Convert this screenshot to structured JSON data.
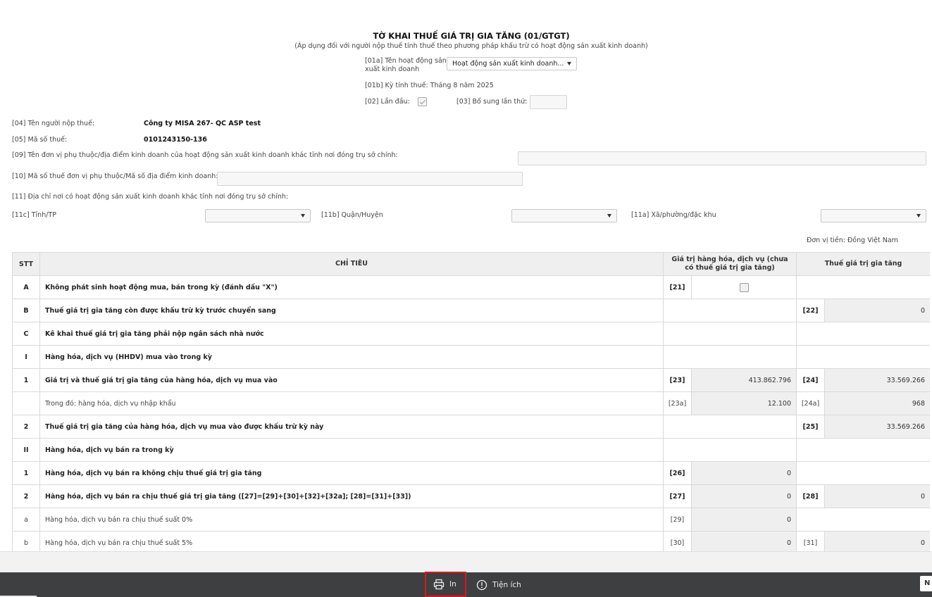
{
  "form": {
    "title": "TỜ KHAI THUẾ GIÁ TRỊ GIA TĂNG (01/GTGT)",
    "subtitle": "(Áp dụng đối với người nộp thuế tính thuế theo phương pháp khấu trừ có hoạt động sản xuất kinh doanh)"
  },
  "header": {
    "activity_label_line1": "[01a] Tên hoạt động sản",
    "activity_label_line2": "xuất kinh doanh",
    "activity_value": "Hoạt động sản xuất kinh doanh...",
    "period": "[01b] Kỳ tính thuế: Tháng 8 năm 2025",
    "first_time_label": "[02] Lần đầu:",
    "first_time_checked": true,
    "supplement_label": "[03] Bổ sung lần thứ:",
    "supplement_value": ""
  },
  "taxpayer": {
    "name_label": "[04] Tên người nộp thuế:",
    "name_value": "Công ty MISA 267- QC ASP test",
    "tax_code_label": "[05] Mã số thuế:",
    "tax_code_value": "0101243150-136",
    "dependent_unit_label": "[09] Tên đơn vị phụ thuộc/địa điểm kinh doanh của hoạt động sản xuất kinh doanh khác tỉnh nơi đóng trụ sở chính:",
    "dependent_unit_value": "",
    "dependent_tax_code_label": "[10] Mã số thuế đơn vị phụ thuộc/Mã số địa điểm kinh doanh:",
    "dependent_tax_code_value": "",
    "address_label": "[11] Địa chỉ nơi có hoạt động sản xuất kinh doanh khác tỉnh nơi đóng trụ sở chính:",
    "province_label": "[11c] Tỉnh/TP",
    "province_value": "",
    "district_label": "[11b] Quận/Huyện",
    "district_value": "",
    "ward_label": "[11a] Xã/phường/đặc khu",
    "ward_value": ""
  },
  "currency_unit": "Đơn vị tiền: Đồng Việt Nam",
  "table": {
    "headers": {
      "stt": "STT",
      "indicator": "CHỈ TIÊU",
      "value": "Giá trị hàng hóa, dịch vụ (chưa có thuế giá trị gia tăng)",
      "tax": "Thuế giá trị gia tăng"
    },
    "rows": [
      {
        "stt": "A",
        "name": "Không phát sinh hoạt động mua, bán trong kỳ (đánh dấu \"X\")",
        "val_code": "[21]",
        "val_checkbox": true,
        "bold": true
      },
      {
        "stt": "B",
        "name": "Thuế giá trị gia tăng còn được khấu trừ kỳ trước chuyển sang",
        "tax_code": "[22]",
        "tax": "0",
        "bold": true
      },
      {
        "stt": "C",
        "name": "Kê khai thuế giá trị gia tăng phải nộp ngân sách nhà nước",
        "bold": true
      },
      {
        "stt": "I",
        "name": "Hàng hóa, dịch vụ (HHDV) mua vào trong kỳ",
        "bold": true
      },
      {
        "stt": "1",
        "name": "Giá trị và thuế giá trị gia tăng của hàng hóa, dịch vụ mua vào",
        "val_code": "[23]",
        "val": "413.862.796",
        "tax_code": "[24]",
        "tax": "33.569.266",
        "bold": true
      },
      {
        "stt": "",
        "name": "Trong đó: hàng hóa, dịch vụ nhập khẩu",
        "val_code": "[23a]",
        "val": "12.100",
        "tax_code": "[24a]",
        "tax": "968",
        "bold": false
      },
      {
        "stt": "2",
        "name": "Thuế giá trị gia tăng của hàng hóa, dịch vụ mua vào được khấu trừ kỳ này",
        "tax_code": "[25]",
        "tax": "33.569.266",
        "bold": true
      },
      {
        "stt": "II",
        "name": "Hàng hóa, dịch vụ bán ra trong kỳ",
        "bold": true
      },
      {
        "stt": "1",
        "name": "Hàng hóa, dịch vụ bán ra không chịu thuế giá trị gia tăng",
        "val_code": "[26]",
        "val": "0",
        "bold": true
      },
      {
        "stt": "2",
        "name": "Hàng hóa, dịch vụ bán ra chịu thuế giá trị gia tăng ([27]=[29]+[30]+[32]+[32a]; [28]=[31]+[33])",
        "val_code": "[27]",
        "val": "0",
        "tax_code": "[28]",
        "tax": "0",
        "bold": true
      },
      {
        "stt": "a",
        "name": "Hàng hóa, dịch vụ bán ra chịu thuế suất 0%",
        "val_code": "[29]",
        "val": "0",
        "bold": false
      },
      {
        "stt": "b",
        "name": "Hàng hóa, dịch vụ bán ra chịu thuế suất 5%",
        "val_code": "[30]",
        "val": "0",
        "tax_code": "[31]",
        "tax": "0",
        "bold": false
      }
    ]
  },
  "footer": {
    "print_label": "In",
    "utilities_label": "Tiện ích",
    "corner_label": "N"
  },
  "colors": {
    "highlight": "#e0151b",
    "footer_bg": "#3d3f41",
    "header_bg": "#efefef"
  }
}
